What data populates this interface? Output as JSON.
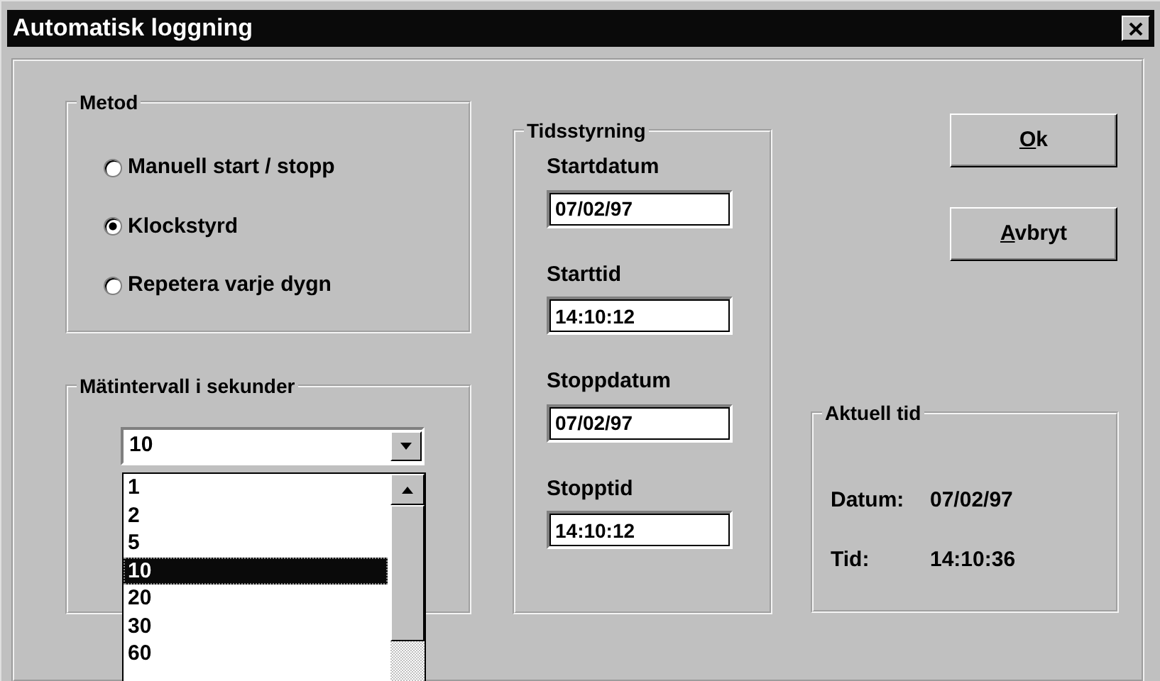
{
  "window": {
    "title": "Automatisk loggning"
  },
  "method": {
    "title": "Metod",
    "options": [
      {
        "label": "Manuell start / stopp",
        "selected": false
      },
      {
        "label": "Klockstyrd",
        "selected": true
      },
      {
        "label": "Repetera varje dygn",
        "selected": false
      }
    ]
  },
  "interval": {
    "title": "Mätintervall i sekunder",
    "value": "10",
    "expanded": true,
    "options": [
      {
        "label": "1",
        "selected": false
      },
      {
        "label": "2",
        "selected": false
      },
      {
        "label": "5",
        "selected": false
      },
      {
        "label": "10",
        "selected": true
      },
      {
        "label": "20",
        "selected": false
      },
      {
        "label": "30",
        "selected": false
      },
      {
        "label": "60",
        "selected": false
      }
    ]
  },
  "timing": {
    "title": "Tidsstyrning",
    "fields": [
      {
        "label": "Startdatum",
        "value": "07/02/97"
      },
      {
        "label": "Starttid",
        "value": "14:10:12"
      },
      {
        "label": "Stoppdatum",
        "value": "07/02/97"
      },
      {
        "label": "Stopptid",
        "value": "14:10:12"
      }
    ]
  },
  "buttons": [
    {
      "label": "Ok",
      "underline_first": true
    },
    {
      "label": "Avbryt",
      "underline_first": true
    }
  ],
  "current_time": {
    "title": "Aktuell tid",
    "rows": [
      {
        "label": "Datum:",
        "value": "07/02/97"
      },
      {
        "label": "Tid:",
        "value": "14:10:36"
      }
    ]
  }
}
